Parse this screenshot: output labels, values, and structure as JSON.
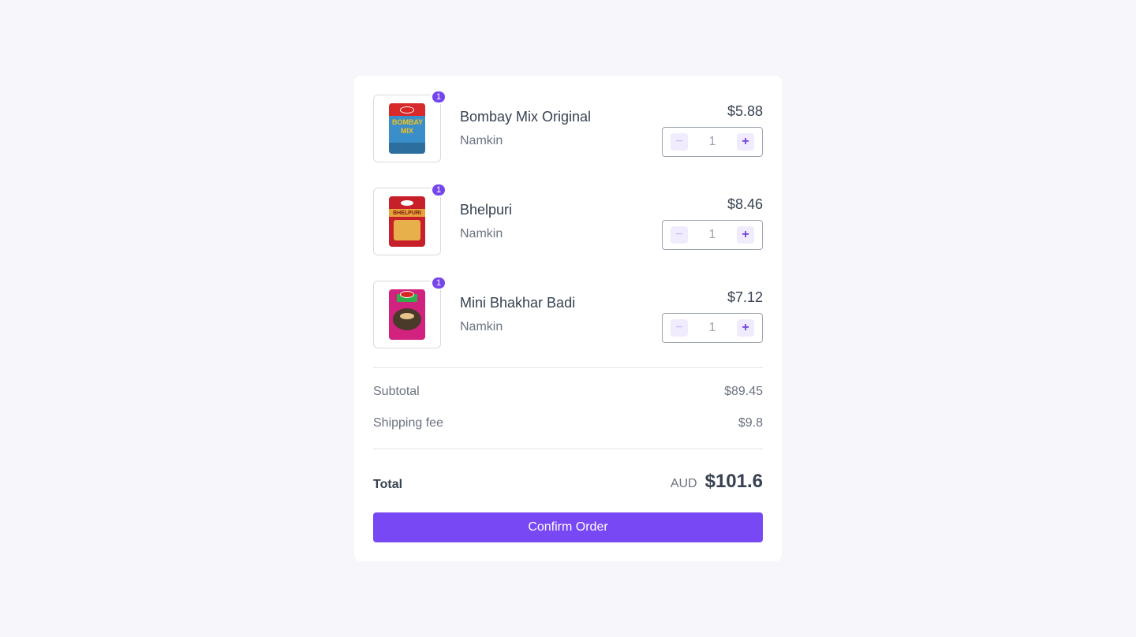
{
  "cart": {
    "items": [
      {
        "name": "Bombay Mix Original",
        "category": "Namkin",
        "price": "$5.88",
        "quantity": "1",
        "badge": "1",
        "image_icon": "bombay-mix-pack-image",
        "pack_colors": {
          "top": "#d82a2a",
          "mid": "#3a8ec9",
          "word": "#f4c21b"
        }
      },
      {
        "name": "Bhelpuri",
        "category": "Namkin",
        "price": "$8.46",
        "quantity": "1",
        "badge": "1",
        "image_icon": "bhelpuri-pack-image",
        "pack_colors": {
          "top": "#c8202a",
          "mid": "#e8b04a",
          "word": "#ffffff"
        }
      },
      {
        "name": "Mini Bhakhar Badi",
        "category": "Namkin",
        "price": "$7.12",
        "quantity": "1",
        "badge": "1",
        "image_icon": "mini-bhakhar-badi-pack-image",
        "pack_colors": {
          "top": "#d2227f",
          "mid": "#4a3a2a",
          "word": "#2fae4a"
        }
      }
    ],
    "minus_icon": "minus-icon",
    "plus_icon": "plus-icon"
  },
  "summary": {
    "subtotal_label": "Subtotal",
    "subtotal_value": "$89.45",
    "shipping_label": "Shipping fee",
    "shipping_value": "$9.8",
    "total_label": "Total",
    "currency": "AUD",
    "total_value": "$101.6"
  },
  "actions": {
    "confirm_label": "Confirm Order"
  },
  "colors": {
    "accent": "#7848f4",
    "badge": "#7545ec",
    "background": "#f7f7fb"
  }
}
